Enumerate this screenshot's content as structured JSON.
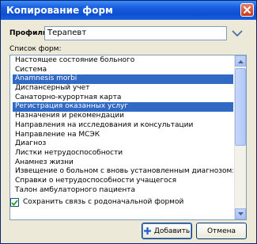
{
  "window": {
    "title": "Копирование форм"
  },
  "profile": {
    "label": "Профиль:",
    "value": "Терапевт"
  },
  "forms": {
    "label": "Список форм:",
    "items": [
      {
        "label": "Настоящее состояние больного",
        "selected": false
      },
      {
        "label": "Система",
        "selected": false
      },
      {
        "label": "Anamnesis morbi",
        "selected": true
      },
      {
        "label": "Диспансерный учет",
        "selected": false
      },
      {
        "label": "Санаторно-курортная карта",
        "selected": false
      },
      {
        "label": "Регистрация оказанных услуг",
        "selected": true
      },
      {
        "label": "Назначения и рекомендации",
        "selected": false
      },
      {
        "label": "Направления на исследования и консультации",
        "selected": false
      },
      {
        "label": "Направление на МСЭК",
        "selected": false
      },
      {
        "label": "Диагноз",
        "selected": false
      },
      {
        "label": "Листки нетрудоспособности",
        "selected": false
      },
      {
        "label": "Анамнез жизни",
        "selected": false
      },
      {
        "label": "Извещение о больном с вновь установленным диагнозом: сифил",
        "selected": false
      },
      {
        "label": "Справки о нетрудоспособности учащегося",
        "selected": false
      },
      {
        "label": "Талон амбулаторного пациента",
        "selected": false
      }
    ]
  },
  "link_option": {
    "label": "Сохранить связь с родоначальной формой",
    "checked": true
  },
  "buttons": {
    "add": "Добавить",
    "cancel": "Отмена"
  },
  "colors": {
    "selection": "#316ac5",
    "titlebar": "#0d4fd0",
    "dialog_bg": "#ece9d8"
  },
  "icons": {
    "close": "close-icon",
    "dropdown": "chevron-down-icon",
    "add": "add-icon",
    "check": "check-icon"
  }
}
